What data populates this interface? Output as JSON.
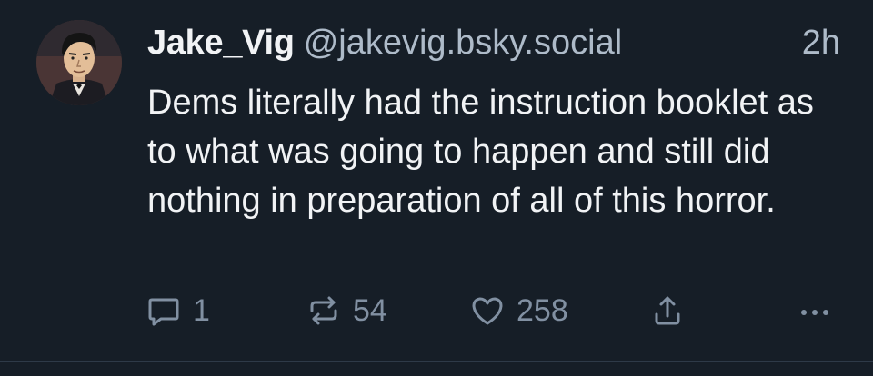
{
  "post": {
    "author": {
      "display_name": "Jake_Vig",
      "handle": "@jakevig.bsky.social",
      "avatar_icon": "cartoon-man-avatar"
    },
    "timestamp": "2h",
    "text": "Dems literally had the instruction booklet as to what was going to happen and still did nothing in preparation of all of this horror.",
    "actions": {
      "reply_count": "1",
      "repost_count": "54",
      "like_count": "258",
      "share_icon": "share-icon",
      "more_icon": "more-icon"
    }
  },
  "colors": {
    "background": "#161e27",
    "text": "#f1f3f5",
    "muted": "#aebbc9",
    "icon": "#8190a2"
  }
}
